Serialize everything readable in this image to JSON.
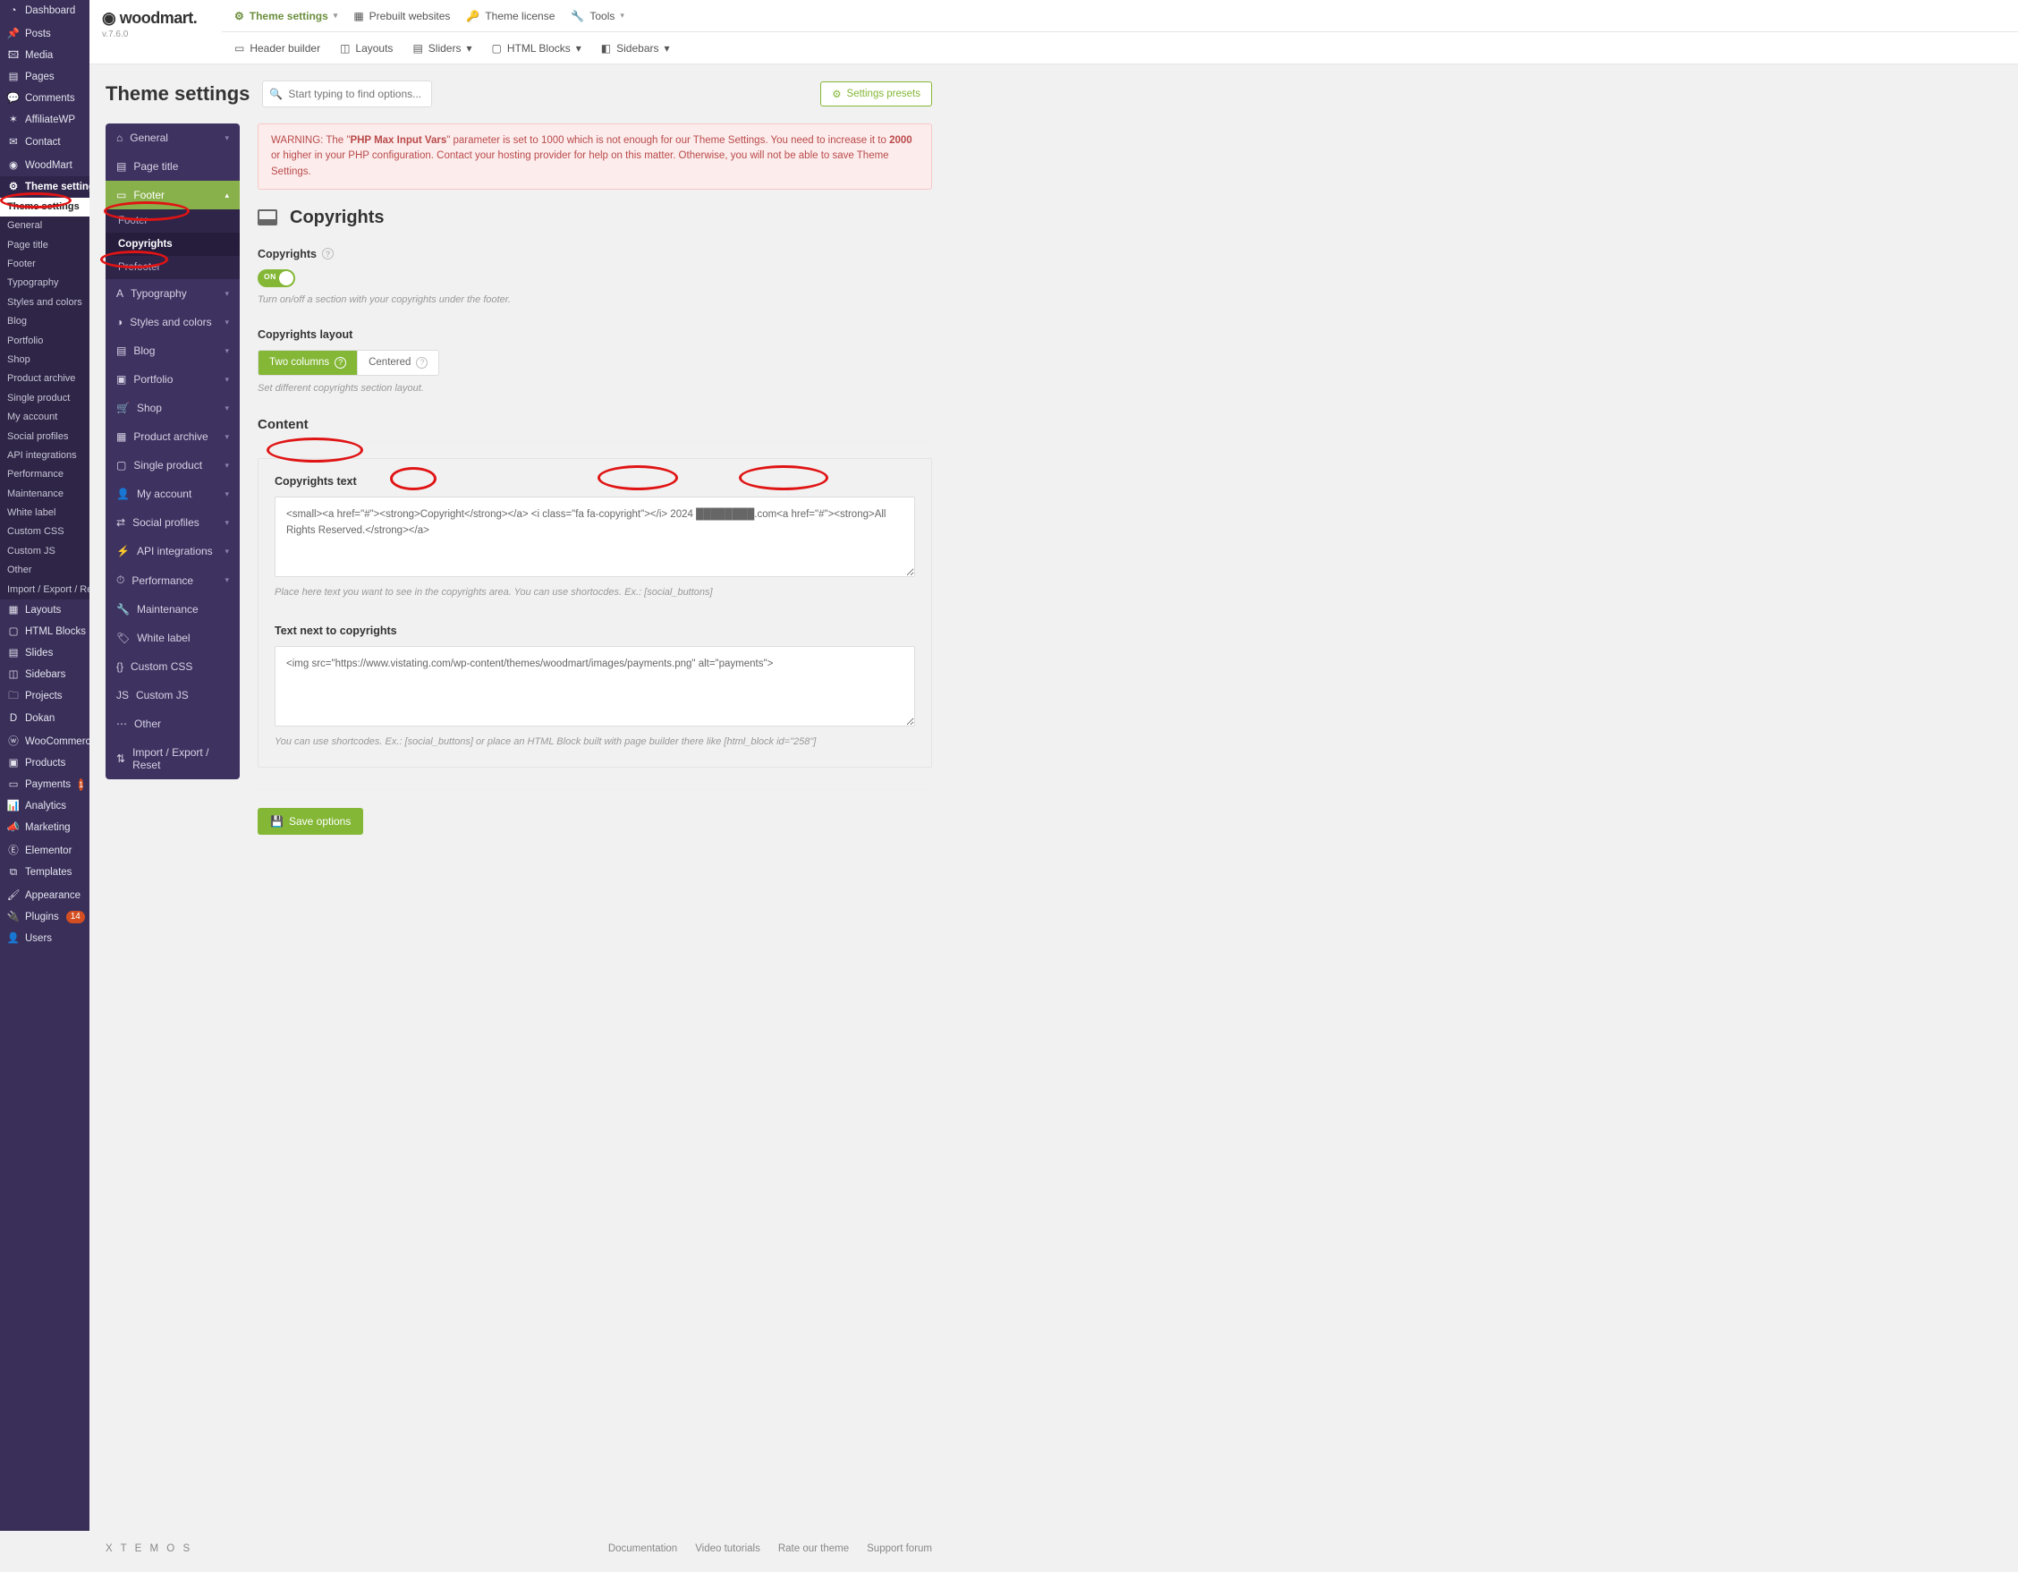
{
  "wp_sidebar": {
    "dashboard": "Dashboard",
    "posts": "Posts",
    "media": "Media",
    "pages": "Pages",
    "comments": "Comments",
    "affiliatewp": "AffiliateWP",
    "contact": "Contact",
    "woodmart": "WoodMart",
    "theme_settings": "Theme settings",
    "ts_sub": [
      "Theme settings",
      "General",
      "Page title",
      "Footer",
      "Typography",
      "Styles and colors",
      "Blog",
      "Portfolio",
      "Shop",
      "Product archive",
      "Single product",
      "My account",
      "Social profiles",
      "API integrations",
      "Performance",
      "Maintenance",
      "White label",
      "Custom CSS",
      "Custom JS",
      "Other",
      "Import / Export / Reset"
    ],
    "layouts": "Layouts",
    "html_blocks": "HTML Blocks",
    "slides": "Slides",
    "sidebars": "Sidebars",
    "projects": "Projects",
    "dokan": "Dokan",
    "woocommerce": "WooCommerce",
    "products": "Products",
    "payments": "Payments",
    "payments_badge": "1",
    "analytics": "Analytics",
    "marketing": "Marketing",
    "elementor": "Elementor",
    "templates": "Templates",
    "appearance": "Appearance",
    "plugins": "Plugins",
    "plugins_badge": "14",
    "users": "Users"
  },
  "logo": {
    "brand": "woodmart.",
    "version": "v.7.6.0"
  },
  "topbar1": {
    "theme_settings": "Theme settings",
    "prebuilt": "Prebuilt websites",
    "license": "Theme license",
    "tools": "Tools"
  },
  "topbar2": {
    "header": "Header builder",
    "layouts": "Layouts",
    "sliders": "Sliders",
    "html_blocks": "HTML Blocks",
    "sidebars": "Sidebars"
  },
  "page": {
    "title": "Theme settings",
    "search_placeholder": "Start typing to find options...",
    "presets_btn": "Settings presets"
  },
  "settings_nav": {
    "general": "General",
    "page_title": "Page title",
    "footer": "Footer",
    "footer_sub": {
      "footer": "Footer",
      "copyrights": "Copyrights",
      "prefooter": "Prefooter"
    },
    "typography": "Typography",
    "styles": "Styles and colors",
    "blog": "Blog",
    "portfolio": "Portfolio",
    "shop": "Shop",
    "product_archive": "Product archive",
    "single_product": "Single product",
    "my_account": "My account",
    "social": "Social profiles",
    "api": "API integrations",
    "performance": "Performance",
    "maintenance": "Maintenance",
    "white_label": "White label",
    "custom_css": "Custom CSS",
    "custom_js": "Custom JS",
    "other": "Other",
    "import": "Import / Export / Reset"
  },
  "alert": {
    "pre": "WARNING: The \"",
    "b1": "PHP Max Input Vars",
    "mid1": "\" parameter is set to 1000 which is not enough for our Theme Settings. You need to increase it to ",
    "b2": "2000",
    "post": " or higher in your PHP configuration. Contact your hosting provider for help on this matter. Otherwise, you will not be able to save Theme Settings."
  },
  "section": {
    "title": "Copyrights",
    "copyrights_label": "Copyrights",
    "switch_on": "ON",
    "switch_hint": "Turn on/off a section with your copyrights under the footer.",
    "layout_label": "Copyrights layout",
    "layout_opts": {
      "two_cols": "Two columns",
      "centered": "Centered"
    },
    "layout_hint": "Set different copyrights section layout.",
    "content_h": "Content",
    "copy_text_label": "Copyrights text",
    "copy_text_value": "<small><a href=\"#\"><strong>Copyright</strong></a> <i class=\"fa fa-copyright\"></i> 2024 ████████.com<a href=\"#\"><strong>All Rights Reserved.</strong></a>",
    "copy_text_hint": "Place here text you want to see in the copyrights area. You can use shortocdes. Ex.: [social_buttons]",
    "text_next_label": "Text next to copyrights",
    "text_next_value": "<img src=\"https://www.vistating.com/wp-content/themes/woodmart/images/payments.png\" alt=\"payments\">",
    "text_next_hint": "You can use shortcodes. Ex.: [social_buttons] or place an HTML Block built with page builder there like [html_block id=\"258\"]",
    "save": "Save options"
  },
  "footer": {
    "xtemos": "X T E M O S",
    "links": [
      "Documentation",
      "Video tutorials",
      "Rate our theme",
      "Support forum"
    ]
  }
}
